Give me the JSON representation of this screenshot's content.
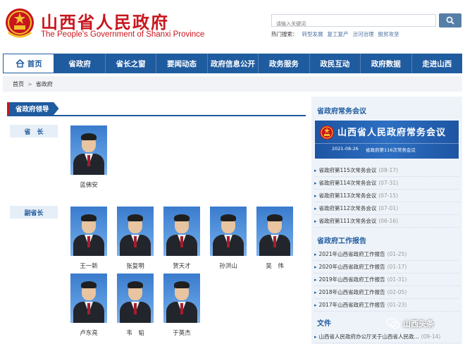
{
  "header": {
    "title": "山西省人民政府",
    "subtitle": "The People's Government of Shanxi Province",
    "search_placeholder": "请输入关键词",
    "hot_label": "热门搜索：",
    "hot_items": [
      "转型发展",
      "复工复产",
      "汾河治理",
      "脱贫攻坚"
    ]
  },
  "nav": {
    "items": [
      "首页",
      "省政府",
      "省长之窗",
      "要闻动态",
      "政府信息公开",
      "政务服务",
      "政民互动",
      "政府数据",
      "走进山西"
    ]
  },
  "breadcrumb": {
    "home": "首页",
    "separator": ">",
    "current": "省政府"
  },
  "leaders": {
    "section_title": "省政府领导",
    "governor_label": "省　长",
    "vice_label": "副省长",
    "governor": "蓝佛安",
    "vice_governors": [
      "王一新",
      "张复明",
      "贺天才",
      "孙洪山",
      "吴　伟",
      "卢东亮",
      "韦　韬",
      "于英杰"
    ]
  },
  "sidebar": {
    "meetings_title": "省政府常务会议",
    "banner_title": "山西省人民政府常务会议",
    "banner_date": "2021-08-26",
    "banner_sub": "省政府第116次常务会议",
    "meetings": [
      {
        "text": "省政府第115次常务会议",
        "date": "(08-17)"
      },
      {
        "text": "省政府第114次常务会议",
        "date": "(07-31)"
      },
      {
        "text": "省政府第113次常务会议",
        "date": "(07-15)"
      },
      {
        "text": "省政府第112次常务会议",
        "date": "(07-01)"
      },
      {
        "text": "省政府第111次常务会议",
        "date": "(06-16)"
      }
    ],
    "reports_title": "省政府工作报告",
    "reports": [
      {
        "text": "2021年山西省政府工作报告",
        "date": "(01-25)"
      },
      {
        "text": "2020年山西省政府工作报告",
        "date": "(01-17)"
      },
      {
        "text": "2019年山西省政府工作报告",
        "date": "(01-31)"
      },
      {
        "text": "2018年山西省政府工作报告",
        "date": "(02-05)"
      },
      {
        "text": "2017年山西省政府工作报告",
        "date": "(01-23)"
      }
    ],
    "docs_title": "文件",
    "docs": [
      {
        "text": "山西省人民政府办公厅关于山西省人民政...",
        "date": "(09-14)"
      }
    ]
  },
  "watermark": "山西头条",
  "colors": {
    "brand_red": "#c8161d",
    "nav_blue": "#1f5b9f",
    "sidebar_bg": "#eef3f9"
  }
}
